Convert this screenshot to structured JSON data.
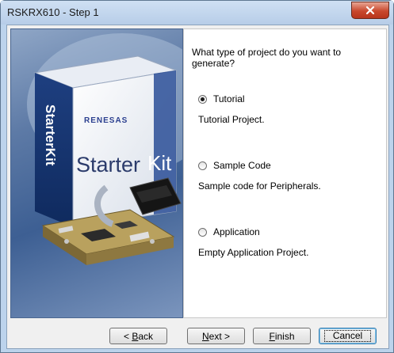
{
  "window": {
    "title": "RSKRX610 - Step 1",
    "close_icon": "close-x-icon"
  },
  "art": {
    "brand": "RENESAS",
    "product_prefix": "Starter",
    "product_suffix": "Kit",
    "spine_text": "StarterKit"
  },
  "panel": {
    "question": "What type of project do you want to generate?",
    "options": [
      {
        "label": "Tutorial",
        "description": "Tutorial Project.",
        "selected": true
      },
      {
        "label": "Sample Code",
        "description": "Sample code for Peripherals.",
        "selected": false
      },
      {
        "label": "Application",
        "description": "Empty Application Project.",
        "selected": false
      }
    ]
  },
  "buttons": {
    "back": {
      "pre": "< ",
      "key": "B",
      "rest": "ack"
    },
    "next": {
      "key": "N",
      "rest": "ext >"
    },
    "finish": {
      "key": "F",
      "rest": "inish"
    },
    "cancel": "Cancel"
  }
}
